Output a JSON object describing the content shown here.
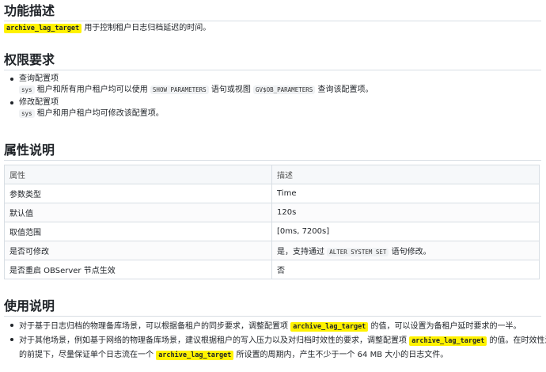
{
  "function_desc": {
    "heading": "功能描述",
    "param_code": "archive_lag_target",
    "text": "用于控制租户日志归档延迟的时间。"
  },
  "permission": {
    "heading": "权限要求",
    "items": [
      {
        "title": "查询配置项",
        "detail": {
          "code1": "sys",
          "text1": "租户和所有用户租户均可以使用",
          "code2": "SHOW PARAMETERS",
          "text2": "语句或视图",
          "code3": "GV$OB_PARAMETERS",
          "text3": "查询该配置项。"
        }
      },
      {
        "title": "修改配置项",
        "detail": {
          "code1": "sys",
          "text1": "租户和用户租户均可修改该配置项。"
        }
      }
    ]
  },
  "attributes": {
    "heading": "属性说明",
    "columns": [
      "属性",
      "描述"
    ],
    "rows": [
      {
        "attr": "参数类型",
        "desc": "Time"
      },
      {
        "attr": "默认值",
        "desc": "120s"
      },
      {
        "attr": "取值范围",
        "desc": "[0ms, 7200s]"
      },
      {
        "attr": "是否可修改",
        "desc_prefix": "是，支持通过",
        "desc_code": "ALTER SYSTEM SET",
        "desc_suffix": "语句修改。"
      },
      {
        "attr": "是否重启 OBServer 节点生效",
        "desc": "否"
      }
    ]
  },
  "usage": {
    "heading": "使用说明",
    "items": [
      {
        "text1": "对于基于日志归档的物理备库场景，可以根据备租户的同步要求，调整配置项",
        "code": "archive_lag_target",
        "text2": "的值，可以设置为备租户延时要求的一半。"
      },
      {
        "text1": "对于其他场景，例如基于网络的物理备库场景，建议根据租户的写入压力以及对归档时效性的要求，调整配置项",
        "code": "archive_lag_target",
        "text2": "的值。在时效性满足",
        "line2_text1": "的前提下，尽量保证单个日志流在一个",
        "line2_code": "archive_lag_target",
        "line2_text2": "所设置的周期内，产生不少于一个 64 MB 大小的日志文件。"
      }
    ]
  }
}
